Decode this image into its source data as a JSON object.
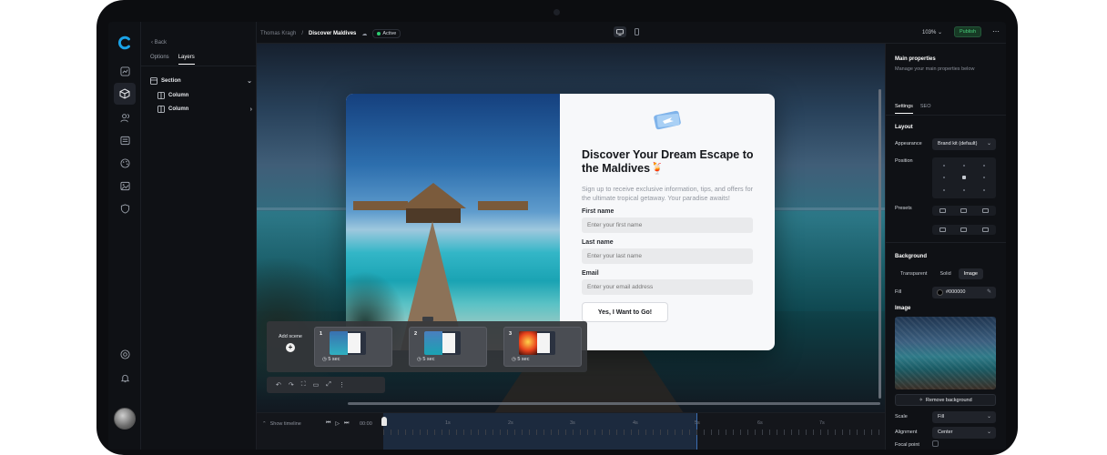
{
  "breadcrumb": {
    "owner": "Thomas Kragh",
    "separator": "/",
    "project": "Discover Maldives",
    "status": "Active"
  },
  "topbar": {
    "zoom": "103%",
    "publish_label": "Publish"
  },
  "layers_panel": {
    "back_label": "Back",
    "tabs": [
      {
        "label": "Options"
      },
      {
        "label": "Layers"
      }
    ],
    "items": [
      {
        "label": "Section"
      },
      {
        "label": "Column"
      },
      {
        "label": "Column"
      }
    ]
  },
  "form": {
    "title": "Discover Your Dream Escape to the Maldives🍹",
    "description": "Sign up to receive exclusive information, tips, and offers for the ultimate tropical getaway. Your paradise awaits!",
    "fields": [
      {
        "label": "First name",
        "placeholder": "Enter your first name"
      },
      {
        "label": "Last name",
        "placeholder": "Enter your last name"
      },
      {
        "label": "Email",
        "placeholder": "Enter your email address"
      }
    ],
    "button_label": "Yes, I Want to Go!"
  },
  "scenes": {
    "add_label": "Add scene",
    "items": [
      {
        "number": "1",
        "duration": "5 sec"
      },
      {
        "number": "2",
        "duration": "5 sec"
      },
      {
        "number": "3",
        "duration": "5 sec"
      }
    ]
  },
  "timeline": {
    "show_label": "Show timeline",
    "current_time": "00:00",
    "ticks": [
      "1s",
      "2s",
      "3s",
      "4s",
      "5s",
      "6s",
      "7s"
    ]
  },
  "properties": {
    "title": "Main properties",
    "subtitle": "Manage your main properties below",
    "tabs": [
      {
        "label": "Settings"
      },
      {
        "label": "SEO"
      }
    ],
    "layout_heading": "Layout",
    "appearance_label": "Appearance",
    "appearance_value": "Brand kit (default)",
    "position_label": "Position",
    "presets_label": "Presets",
    "background_heading": "Background",
    "background_options": [
      {
        "label": "Transparent"
      },
      {
        "label": "Solid"
      },
      {
        "label": "Image"
      }
    ],
    "fill_label": "Fill",
    "fill_value": "#000000",
    "image_heading": "Image",
    "remove_bg_label": "Remove background",
    "scale_label": "Scale",
    "scale_value": "Fill",
    "alignment_label": "Alignment",
    "alignment_value": "Center",
    "focal_label": "Focal point"
  },
  "colors": {
    "accent": "#2ecc71",
    "publish_text": "#48d17d",
    "brand_logo": "#1aa3e8"
  }
}
